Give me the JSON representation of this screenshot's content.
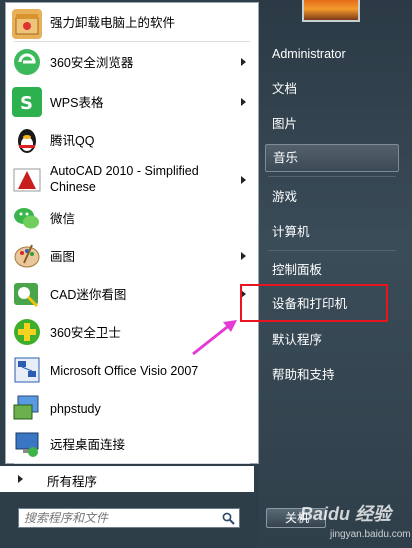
{
  "programs": [
    {
      "label": "强力卸载电脑上的软件",
      "icon": "uninstall-box-icon",
      "color": "#e6a74a"
    },
    {
      "label": "360安全浏览器",
      "icon": "360-browser-icon",
      "color": "#2fa84a",
      "submenu": true
    },
    {
      "label": "WPS表格",
      "icon": "wps-spreadsheet-icon",
      "color": "#2db04e",
      "submenu": true
    },
    {
      "label": "腾讯QQ",
      "icon": "qq-penguin-icon",
      "color": "#1a1a1a"
    },
    {
      "label": "AutoCAD 2010 - Simplified Chinese",
      "icon": "autocad-icon",
      "color": "#c81e1e",
      "submenu": true
    },
    {
      "label": "微信",
      "icon": "wechat-icon",
      "color": "#3bb54a"
    },
    {
      "label": "画图",
      "icon": "paint-palette-icon",
      "color": "#d28a35",
      "submenu": true
    },
    {
      "label": "CAD迷你看图",
      "icon": "cad-viewer-icon",
      "color": "#3a9f3a",
      "submenu": true
    },
    {
      "label": "360安全卫士",
      "icon": "360-security-icon",
      "color": "#3fae2a"
    },
    {
      "label": "Microsoft Office Visio 2007",
      "icon": "visio-icon",
      "color": "#2a5eb0"
    },
    {
      "label": "phpstudy",
      "icon": "phpstudy-icon",
      "color": "#4a8a3a"
    },
    {
      "label": "远程桌面连接",
      "icon": "remote-desktop-icon",
      "color": "#3a76c4"
    }
  ],
  "all_programs": "所有程序",
  "search": {
    "placeholder": "搜索程序和文件"
  },
  "right_menu": [
    {
      "label": "Administrator"
    },
    {
      "label": "文档"
    },
    {
      "label": "图片"
    },
    {
      "label": "音乐",
      "highlight": true
    },
    {
      "label": "游戏"
    },
    {
      "label": "计算机"
    },
    {
      "label": "控制面板"
    },
    {
      "label": "设备和打印机",
      "annotated": true
    },
    {
      "label": "默认程序"
    },
    {
      "label": "帮助和支持"
    }
  ],
  "shutdown_label": "关机",
  "watermark": {
    "brand": "Baidu 经验",
    "url": "jingyan.baidu.com"
  },
  "annotation_color": "#e8141e",
  "arrow_color": "#e23bd6"
}
